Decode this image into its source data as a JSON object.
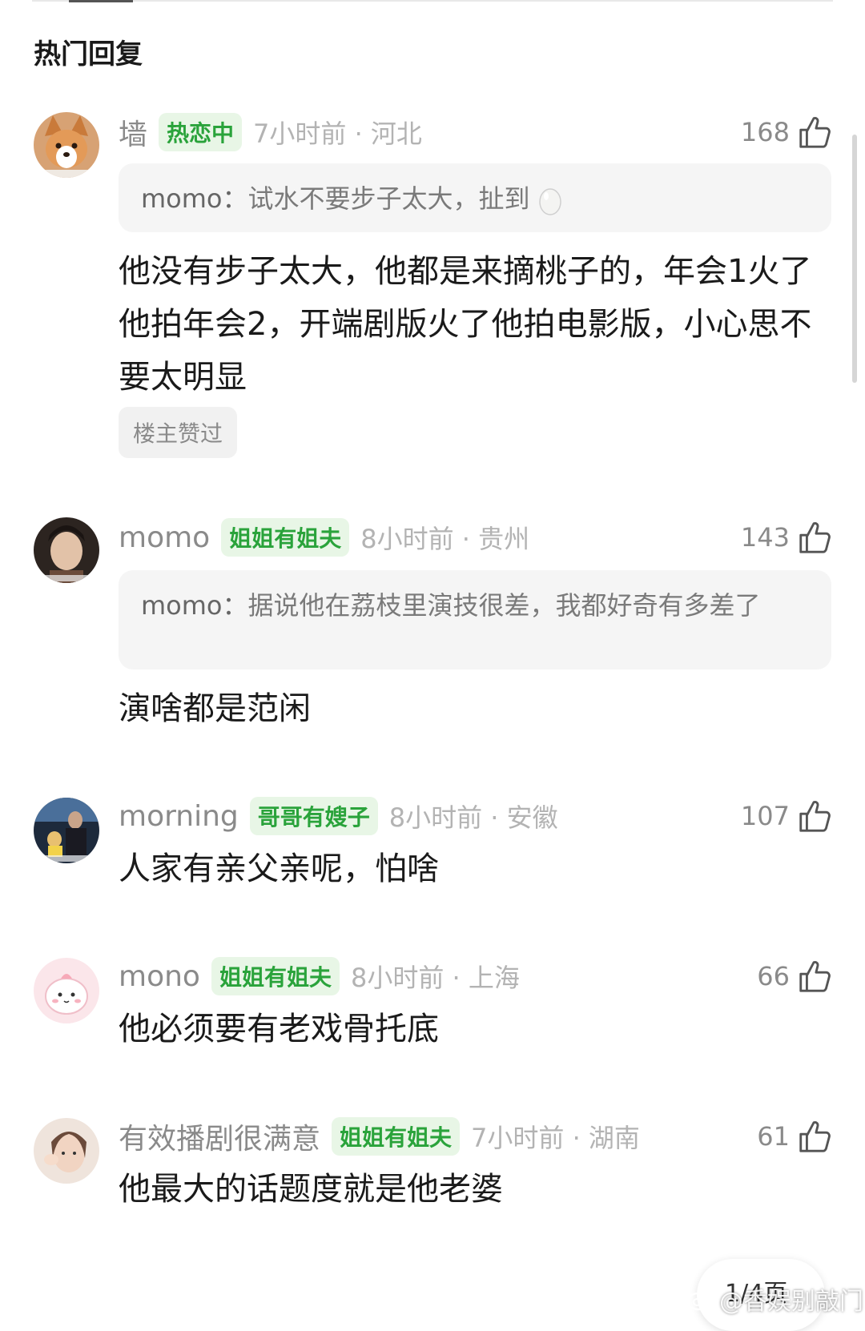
{
  "section_title": "热门回复",
  "comments": [
    {
      "username": "墙",
      "badge": "热恋中",
      "meta": "7小时前 · 河北",
      "likes": "168",
      "quote_name": "momo：",
      "quote_text": "试水不要步子太大，扯到",
      "body": "他没有步子太大，他都是来摘桃子的，年会1火了他拍年会2，开端剧版火了他拍电影版，小心思不要太明显",
      "tag": "楼主赞过"
    },
    {
      "username": "momo",
      "badge": "姐姐有姐夫",
      "meta": "8小时前 · 贵州",
      "likes": "143",
      "quote_name": "momo：",
      "quote_text": "据说他在荔枝里演技很差，我都好奇有多差了",
      "body": "演啥都是范闲"
    },
    {
      "username": "morning",
      "badge": "哥哥有嫂子",
      "meta": "8小时前 · 安徽",
      "likes": "107",
      "body": "人家有亲父亲呢，怕啥"
    },
    {
      "username": "mono",
      "badge": "姐姐有姐夫",
      "meta": "8小时前 · 上海",
      "likes": "66",
      "body": "他必须要有老戏骨托底"
    },
    {
      "username": "有效播剧很满意",
      "badge": "姐姐有姐夫",
      "meta": "7小时前 · 湖南",
      "likes": "61",
      "body": "他最大的话题度就是他老婆"
    }
  ],
  "page_indicator": "1/4页",
  "watermark": "@香娱别敲门",
  "colors": {
    "badge_text": "#2aa33b",
    "badge_bg": "#e8f6e6",
    "quote_bg": "#f5f5f5"
  },
  "icons": [
    "thumbs-up-icon",
    "egg-emoji",
    "weibo-logo-icon"
  ]
}
